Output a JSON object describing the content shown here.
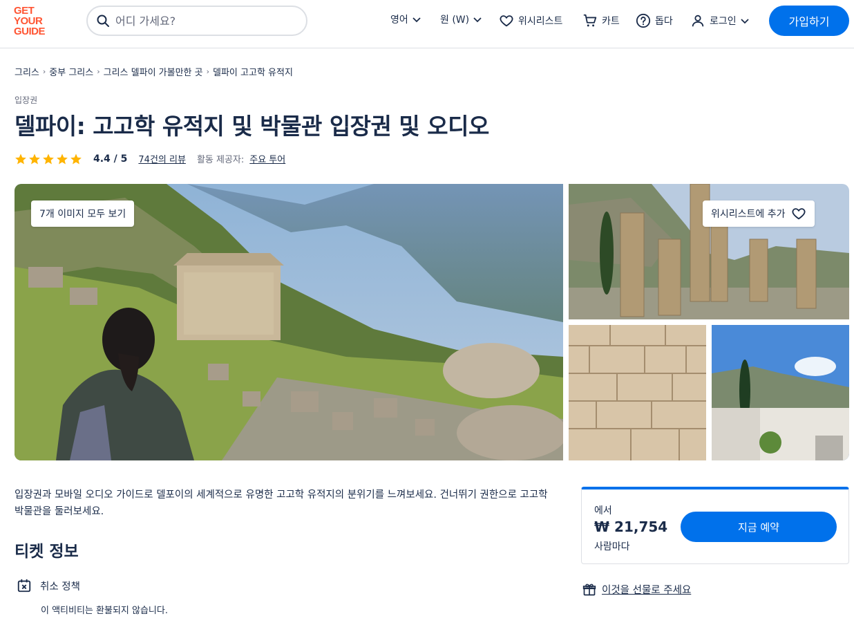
{
  "header": {
    "logo_lines": [
      "GET",
      "YOUR",
      "GUIDE"
    ],
    "search_placeholder": "어디 가세요?",
    "language": "영어",
    "currency": "원 (W)",
    "wishlist": "위시리스트",
    "cart": "카트",
    "help": "돕다",
    "login": "로그인",
    "signup": "가입하기"
  },
  "breadcrumb": [
    "그리스",
    "중부 그리스",
    "그리스 델파이 가볼만한 곳",
    "델파이 고고학 유적지"
  ],
  "category": "입장권",
  "title": "델파이: 고고학 유적지 및 박물관 입장권 및 오디오",
  "rating": {
    "stars": 5,
    "value": "4.4 / 5",
    "reviews_count": "74",
    "reviews_suffix": "건의 리뷰",
    "provider_label": "활동 제공자:",
    "provider": "주요 투어"
  },
  "gallery": {
    "view_all": "7개 이미지 모두 보기",
    "wishlist_add": "위시리스트에 추가"
  },
  "description": "입장권과 모바일 오디오 가이드로 델포이의 세계적으로 유명한 고고학 유적지의 분위기를 느껴보세요. 건너뛰기 권한으로 고고학 박물관을 둘러보세요.",
  "ticket_info": {
    "heading": "티켓 정보",
    "cancel_title": "취소 정책",
    "cancel_text": "이 액티비티는 환불되지 않습니다."
  },
  "booking": {
    "from": "에서",
    "price": "₩ 21,754",
    "per": "사람마다",
    "cta": "지금 예약"
  },
  "gift": "이것을 선물로 주세요",
  "colors": {
    "brand": "#ff5533",
    "primary": "#0071eb",
    "text": "#1a2b49",
    "star": "#ffb400"
  }
}
